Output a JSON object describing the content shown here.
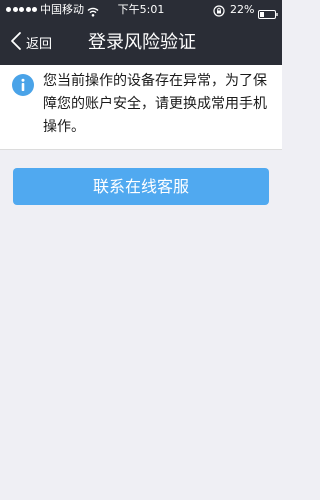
{
  "status_bar": {
    "carrier": "中国移动",
    "time": "下午5:01",
    "battery_percent": "22%",
    "icons": [
      "signal-dots-icon",
      "wifi-icon",
      "rotation-lock-icon",
      "battery-icon"
    ]
  },
  "nav": {
    "back_label": "返回",
    "title": "登录风险验证",
    "back_icon": "chevron-left-icon"
  },
  "notice": {
    "icon": "info-icon",
    "text": "您当前操作的设备存在异常，为了保障您的账户安全，请更换成常用手机操作。"
  },
  "contact_button": {
    "label": "联系在线客服"
  },
  "colors": {
    "header_bg": "#2a2d36",
    "page_bg": "#efeff4",
    "accent": "#50a9f0",
    "info_icon": "#4aa3e8"
  }
}
